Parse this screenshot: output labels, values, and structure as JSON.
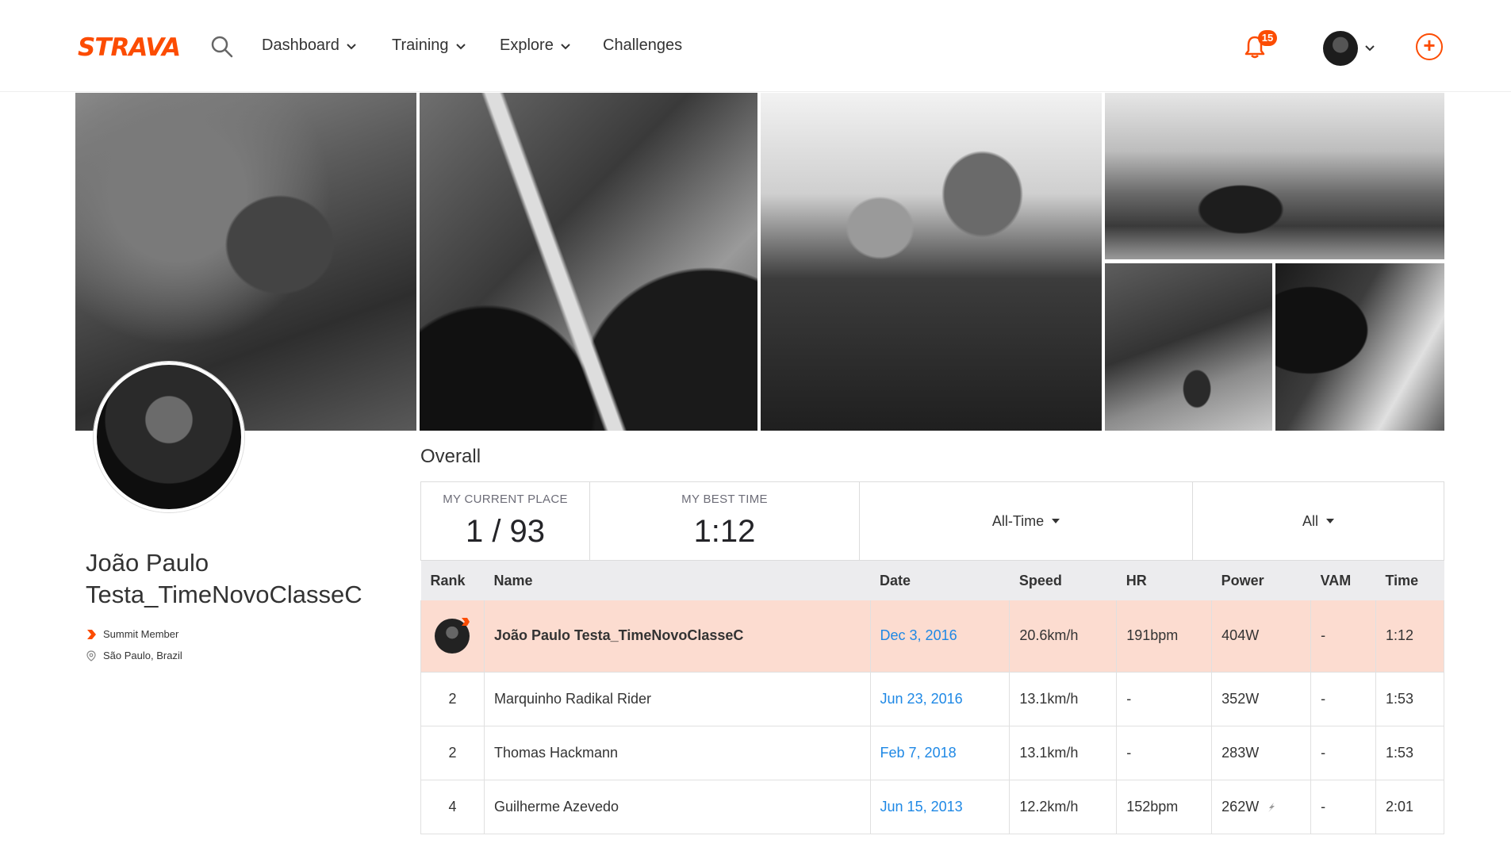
{
  "nav": {
    "logo": "STRAVA",
    "menu": [
      {
        "label": "Dashboard"
      },
      {
        "label": "Training"
      },
      {
        "label": "Explore"
      },
      {
        "label": "Challenges"
      }
    ],
    "notification_count": "15"
  },
  "profile": {
    "name": "João Paulo Testa_TimeNovoClasseC",
    "membership": "Summit Member",
    "location": "São Paulo, Brazil"
  },
  "leaderboard": {
    "title": "Overall",
    "stats": {
      "current_place_label": "MY CURRENT PLACE",
      "current_place_value": "1 / 93",
      "best_time_label": "MY BEST TIME",
      "best_time_value": "1:12"
    },
    "filters": {
      "time_range": "All-Time",
      "group": "All"
    },
    "columns": [
      "Rank",
      "Name",
      "Date",
      "Speed",
      "HR",
      "Power",
      "VAM",
      "Time"
    ],
    "rows": [
      {
        "rank": "",
        "name": "João Paulo Testa_TimeNovoClasseC",
        "date": "Dec 3, 2016",
        "speed": "20.6km/h",
        "hr": "191bpm",
        "power": "404W",
        "vam": "-",
        "time": "1:12"
      },
      {
        "rank": "2",
        "name": "Marquinho Radikal Rider",
        "date": "Jun 23, 2016",
        "speed": "13.1km/h",
        "hr": "-",
        "power": "352W",
        "vam": "-",
        "time": "1:53"
      },
      {
        "rank": "2",
        "name": "Thomas Hackmann",
        "date": "Feb 7, 2018",
        "speed": "13.1km/h",
        "hr": "-",
        "power": "283W",
        "vam": "-",
        "time": "1:53"
      },
      {
        "rank": "4",
        "name": "Guilherme Azevedo",
        "date": "Jun 15, 2013",
        "speed": "12.2km/h",
        "hr": "152bpm",
        "power": "262W",
        "vam": "-",
        "time": "2:01"
      }
    ]
  }
}
